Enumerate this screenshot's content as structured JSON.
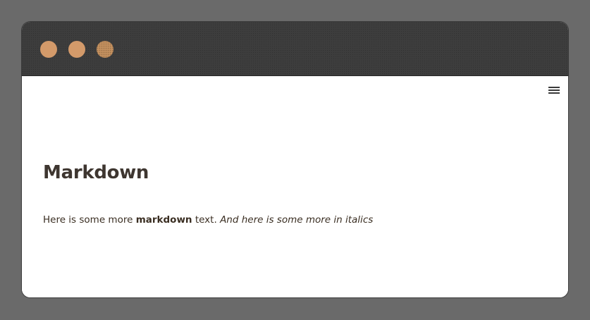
{
  "window": {
    "traffic_lights": [
      "close",
      "minimize",
      "zoom"
    ],
    "colors": {
      "titlebar": "#3d3d3d",
      "dot": "#d39a6a",
      "text": "#3e3630"
    }
  },
  "menu": {
    "icon": "hamburger-menu-icon"
  },
  "page": {
    "title": "Markdown",
    "paragraph": {
      "part1": "Here is some more ",
      "bold": "markdown",
      "part2": " text. ",
      "italic": "And here is some more in italics"
    }
  }
}
